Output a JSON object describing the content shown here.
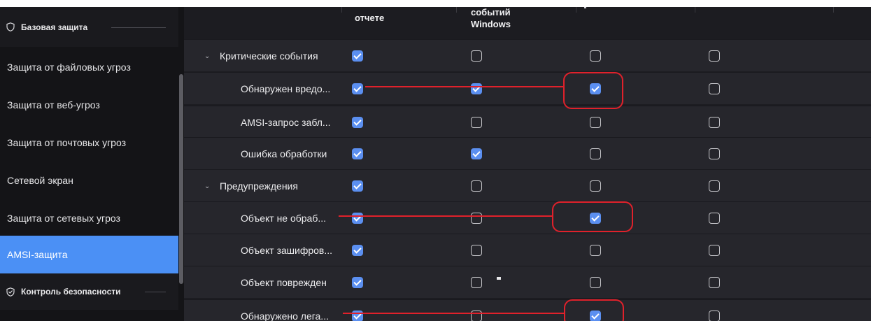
{
  "sidebar": {
    "section1": {
      "label": "Базовая защита",
      "icon": "shield-icon"
    },
    "items": [
      {
        "label": "Защита от файловых угроз"
      },
      {
        "label": "Защита от веб-угроз"
      },
      {
        "label": "Защита от почтовых угроз"
      },
      {
        "label": "Сетевой экран"
      },
      {
        "label": "Защита от сетевых угроз"
      },
      {
        "label": "AMSI-защита",
        "active": true
      }
    ],
    "section2": {
      "label": "Контроль безопасности",
      "icon": "security-control-icon"
    }
  },
  "table": {
    "headers": {
      "report": "отчете",
      "windows_events_line1": "событий",
      "windows_events_line2": "Windows"
    },
    "rows": [
      {
        "label": "Критические события",
        "group": true,
        "checks": [
          true,
          false,
          false,
          false
        ]
      },
      {
        "label": "Обнаружен вредо...",
        "checks": [
          true,
          true,
          true,
          false
        ]
      },
      {
        "label": "AMSI-запрос забл...",
        "checks": [
          true,
          false,
          false,
          false
        ]
      },
      {
        "label": "Ошибка обработки",
        "checks": [
          true,
          true,
          false,
          false
        ]
      },
      {
        "label": "Предупреждения",
        "group": true,
        "checks": [
          true,
          false,
          false,
          false
        ]
      },
      {
        "label": "Объект не обраб...",
        "checks": [
          true,
          false,
          true,
          false
        ]
      },
      {
        "label": "Объект зашифров...",
        "checks": [
          true,
          false,
          false,
          false
        ]
      },
      {
        "label": "Объект поврежден",
        "checks": [
          true,
          false,
          false,
          false
        ]
      },
      {
        "label": "Обнаружено лега...",
        "checks": [
          true,
          false,
          true,
          false
        ]
      }
    ]
  },
  "colors": {
    "accent": "#4b90f5",
    "checkbox_on": "#5b8ff0",
    "annotation": "#e0212b"
  }
}
